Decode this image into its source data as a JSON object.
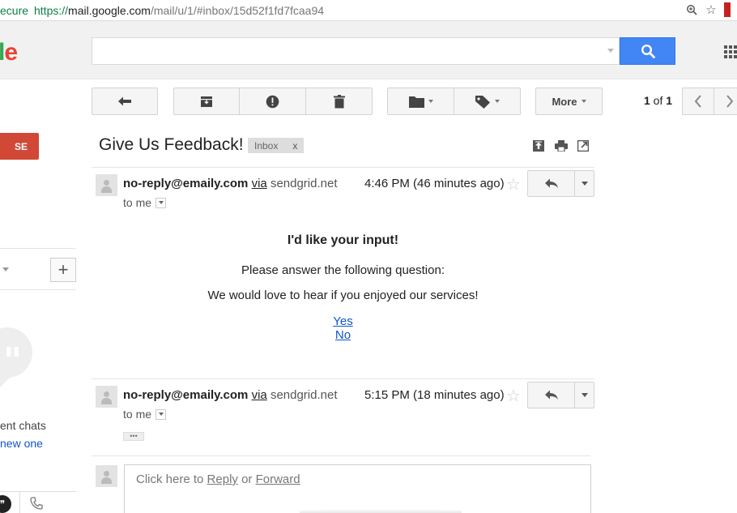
{
  "browser": {
    "secure_fragment": "ecure",
    "url_scheme": "https://",
    "url_host": "mail.google.com",
    "url_path": "/mail/u/1/#inbox/15d52f1fd7fcaa94",
    "icons": [
      "zoom-icon",
      "bookmark-star-icon",
      "extension-icon"
    ]
  },
  "header": {
    "logo_fragment_l": "l",
    "logo_fragment_e": "e",
    "search_value": "",
    "search_placeholder": ""
  },
  "toolbar": {
    "more_label": "More",
    "pager_current": "1",
    "pager_of": " of ",
    "pager_total": "1"
  },
  "sidebar": {
    "compose_fragment": "SE",
    "hangouts_recent": "ent chats",
    "hangouts_new": "new one",
    "plus_label": "+"
  },
  "thread": {
    "subject": "Give Us Feedback!",
    "label": "Inbox",
    "label_remove": "x"
  },
  "messages": [
    {
      "sender": "no-reply@emaily.com",
      "via": "via",
      "domain": "sendgrid.net",
      "time": "4:46 PM (46 minutes ago)",
      "to": "to me"
    },
    {
      "sender": "no-reply@emaily.com",
      "via": "via",
      "domain": "sendgrid.net",
      "time": "5:15 PM (18 minutes ago)",
      "to": "to me"
    }
  ],
  "body": {
    "heading": "I'd like your input!",
    "line1": "Please answer the following question:",
    "line2": "We would love to hear if you enjoyed our services!",
    "yes": "Yes",
    "no": "No"
  },
  "ellipsis": "•••",
  "reply_box": {
    "prefix": "Click here to ",
    "reply": "Reply",
    "or": " or ",
    "forward": "Forward"
  }
}
